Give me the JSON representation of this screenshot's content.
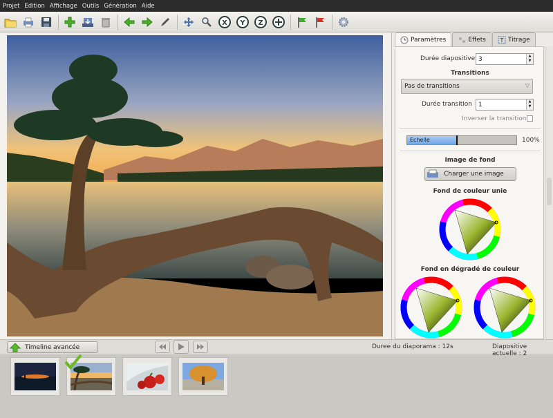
{
  "menu": [
    "Projet",
    "Edition",
    "Affichage",
    "Outils",
    "Génération",
    "Aide"
  ],
  "toolbar": {
    "icons": [
      "open-folder-icon",
      "print-icon",
      "save-icon",
      "add-icon",
      "import-icon",
      "delete-icon",
      "arrow-left-icon",
      "arrow-right-icon",
      "pen-icon",
      "move-icon",
      "zoom-icon",
      "rotate-x-icon",
      "rotate-y-icon",
      "rotate-z-icon",
      "add-center-icon",
      "green-flag-icon",
      "red-flag-icon",
      "settings-gear-icon"
    ],
    "axis_labels": [
      "X",
      "Y",
      "Z"
    ]
  },
  "tabs": [
    {
      "label": "Paramètres",
      "active": true
    },
    {
      "label": "Effets",
      "active": false
    },
    {
      "label": "Titrage",
      "active": false
    }
  ],
  "params": {
    "duree_diapo_label": "Durée diapositive",
    "duree_diapo_value": "3",
    "transitions_title": "Transitions",
    "transition_select": "Pas de transitions",
    "duree_transition_label": "Durée transition",
    "duree_transition_value": "1",
    "inverser_label": "Inverser la transition",
    "echelle_label": "Echelle",
    "echelle_value": "100%",
    "echelle_fraction": 0.45,
    "image_fond_title": "Image de fond",
    "charger_button": "Charger une image",
    "fond_uni_title": "Fond de couleur unie",
    "fond_degrade_title": "Fond en dégradé de couleur"
  },
  "bottom": {
    "timeline_button": "Timeline avancée",
    "duree_diaporama": "Duree du diaporama : 12s",
    "diapo_actuelle": "Diapositive actuelle : 2"
  },
  "thumbnails": [
    {
      "name": "thumb-night-lake",
      "selected": false
    },
    {
      "name": "thumb-tree-lake",
      "selected": true
    },
    {
      "name": "thumb-tomatoes",
      "selected": false
    },
    {
      "name": "thumb-autumn-tree",
      "selected": false
    }
  ],
  "colors": {
    "accent_blue": "#6fa8e8",
    "check_green": "#6cb81e"
  }
}
